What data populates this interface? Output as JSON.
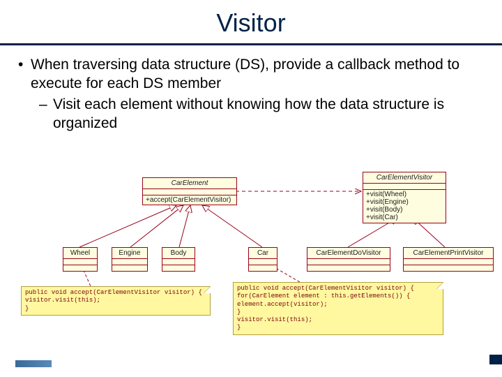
{
  "title": "Visitor",
  "bullets": {
    "b1": "When traversing data structure (DS), provide a callback method to execute for each DS member",
    "b2": "Visit each element without knowing how the data structure is organized"
  },
  "uml": {
    "carElement": {
      "name": "CarElement",
      "op": "+accept(CarElementVisitor)"
    },
    "carElementVisitor": {
      "name": "CarElementVisitor",
      "ops": [
        "+visit(Wheel)",
        "+visit(Engine)",
        "+visit(Body)",
        "+visit(Car)"
      ]
    },
    "wheel": {
      "name": "Wheel"
    },
    "engine": {
      "name": "Engine"
    },
    "body": {
      "name": "Body"
    },
    "car": {
      "name": "Car"
    },
    "doVisitor": {
      "name": "CarElementDoVisitor"
    },
    "printVisitor": {
      "name": "CarElementPrintVisitor"
    }
  },
  "notes": {
    "wheelNote": [
      "public void accept(CarElementVisitor visitor) {",
      "  visitor.visit(this);",
      "}"
    ],
    "carNote": [
      "public void accept(CarElementVisitor visitor) {",
      "  for(CarElement element : this.getElements()) {",
      "    element.accept(visitor);",
      "  }",
      "  visitor.visit(this);",
      "}"
    ]
  },
  "chart_data": {
    "type": "table",
    "title": "Visitor pattern UML class diagram",
    "classes": [
      {
        "name": "CarElement",
        "kind": "abstract",
        "operations": [
          "+accept(CarElementVisitor)"
        ]
      },
      {
        "name": "CarElementVisitor",
        "kind": "abstract",
        "operations": [
          "+visit(Wheel)",
          "+visit(Engine)",
          "+visit(Body)",
          "+visit(Car)"
        ]
      },
      {
        "name": "Wheel",
        "extends": "CarElement"
      },
      {
        "name": "Engine",
        "extends": "CarElement"
      },
      {
        "name": "Body",
        "extends": "CarElement"
      },
      {
        "name": "Car",
        "extends": "CarElement"
      },
      {
        "name": "CarElementDoVisitor",
        "extends": "CarElementVisitor"
      },
      {
        "name": "CarElementPrintVisitor",
        "extends": "CarElementVisitor"
      }
    ],
    "relationships": [
      {
        "from": "Wheel",
        "to": "CarElement",
        "type": "generalization"
      },
      {
        "from": "Engine",
        "to": "CarElement",
        "type": "generalization"
      },
      {
        "from": "Body",
        "to": "CarElement",
        "type": "generalization"
      },
      {
        "from": "Car",
        "to": "CarElement",
        "type": "generalization"
      },
      {
        "from": "CarElementDoVisitor",
        "to": "CarElementVisitor",
        "type": "generalization"
      },
      {
        "from": "CarElementPrintVisitor",
        "to": "CarElementVisitor",
        "type": "generalization"
      },
      {
        "from": "CarElement",
        "to": "CarElementVisitor",
        "type": "dependency"
      }
    ],
    "notes": [
      {
        "attached_to": "Wheel",
        "code": "public void accept(CarElementVisitor visitor) { visitor.visit(this); }"
      },
      {
        "attached_to": "Car",
        "code": "public void accept(CarElementVisitor visitor) { for(CarElement element : this.getElements()) { element.accept(visitor); } visitor.visit(this); }"
      }
    ]
  }
}
